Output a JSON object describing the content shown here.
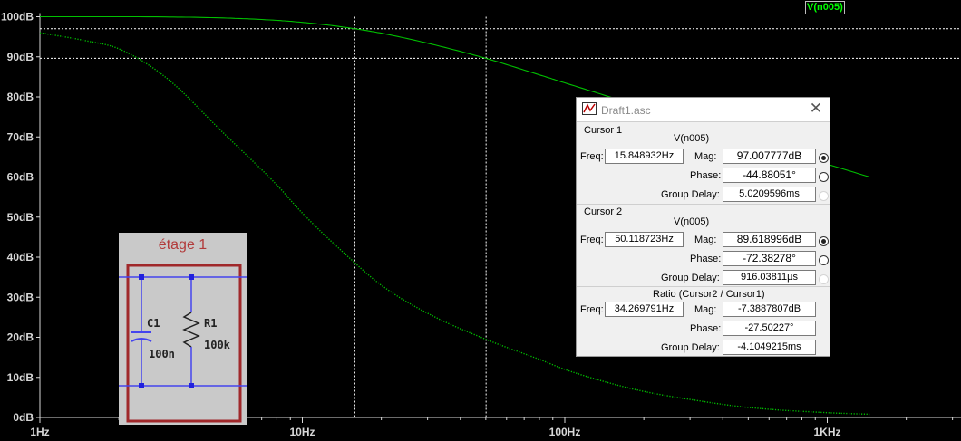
{
  "plot": {
    "trace_label": "V(n005)",
    "y_ticks": [
      "100dB",
      "90dB",
      "80dB",
      "70dB",
      "60dB",
      "50dB",
      "40dB",
      "30dB",
      "20dB",
      "10dB",
      "0dB"
    ],
    "x_ticks": [
      "1Hz",
      "10Hz",
      "100Hz",
      "1KHz"
    ],
    "colors": {
      "background": "#000000",
      "trace": "#00c000",
      "axis": "#d8d8d8",
      "cursor": "#ffffff"
    }
  },
  "chart_data": {
    "type": "line",
    "x_scale": "log",
    "xlim_hz": [
      1,
      1450
    ],
    "ylim_db": [
      0,
      100
    ],
    "series": [
      {
        "name": "V(n005)",
        "style": "solid",
        "x_hz": [
          1,
          3,
          5,
          8,
          10,
          12.6,
          15.85,
          20,
          30,
          50.12,
          80,
          100,
          150,
          200,
          300,
          500,
          1000,
          1450
        ],
        "y_db": [
          100,
          99.95,
          99.7,
          99.1,
          98.6,
          97.9,
          97.0,
          95.9,
          93.4,
          89.6,
          85.5,
          83.5,
          79.9,
          77.3,
          73.7,
          69.2,
          63.2,
          60.0
        ]
      },
      {
        "name": "",
        "style": "dotted",
        "x_hz": [
          1,
          1.5,
          2,
          3,
          5,
          8,
          10,
          15,
          20,
          30,
          50,
          80,
          100,
          150,
          200,
          300,
          500,
          1000,
          1450
        ],
        "y_db": [
          96,
          94,
          92,
          85,
          71,
          58,
          51,
          40,
          33,
          26,
          19.5,
          14.5,
          12,
          8.5,
          6.5,
          4.5,
          2.5,
          1.2,
          0.8
        ]
      }
    ],
    "cursors_hz": [
      15.848932,
      50.118723
    ],
    "cursor_levels_db": [
      97.007777,
      89.618996
    ]
  },
  "schematic": {
    "title": "étage 1",
    "c_label": "C1",
    "c_value": "100n",
    "r_label": "R1",
    "r_value": "100k"
  },
  "dialog": {
    "title": "Draft1.asc",
    "cursor1": {
      "group": "Cursor 1",
      "signal": "V(n005)",
      "freq_label": "Freq:",
      "freq": "15.848932Hz",
      "mag_label": "Mag:",
      "mag": "97.007777dB",
      "phase_label": "Phase:",
      "phase": "-44.88051°",
      "gd_label": "Group Delay:",
      "gd": "5.0209596ms"
    },
    "cursor2": {
      "group": "Cursor 2",
      "signal": "V(n005)",
      "freq_label": "Freq:",
      "freq": "50.118723Hz",
      "mag_label": "Mag:",
      "mag": "89.618996dB",
      "phase_label": "Phase:",
      "phase": "-72.38278°",
      "gd_label": "Group Delay:",
      "gd": "916.03811µs"
    },
    "ratio": {
      "group": "Ratio (Cursor2 / Cursor1)",
      "freq_label": "Freq:",
      "freq": "34.269791Hz",
      "mag_label": "Mag:",
      "mag": "-7.3887807dB",
      "phase_label": "Phase:",
      "phase": "-27.50227°",
      "gd_label": "Group Delay:",
      "gd": "-4.1049215ms"
    }
  }
}
